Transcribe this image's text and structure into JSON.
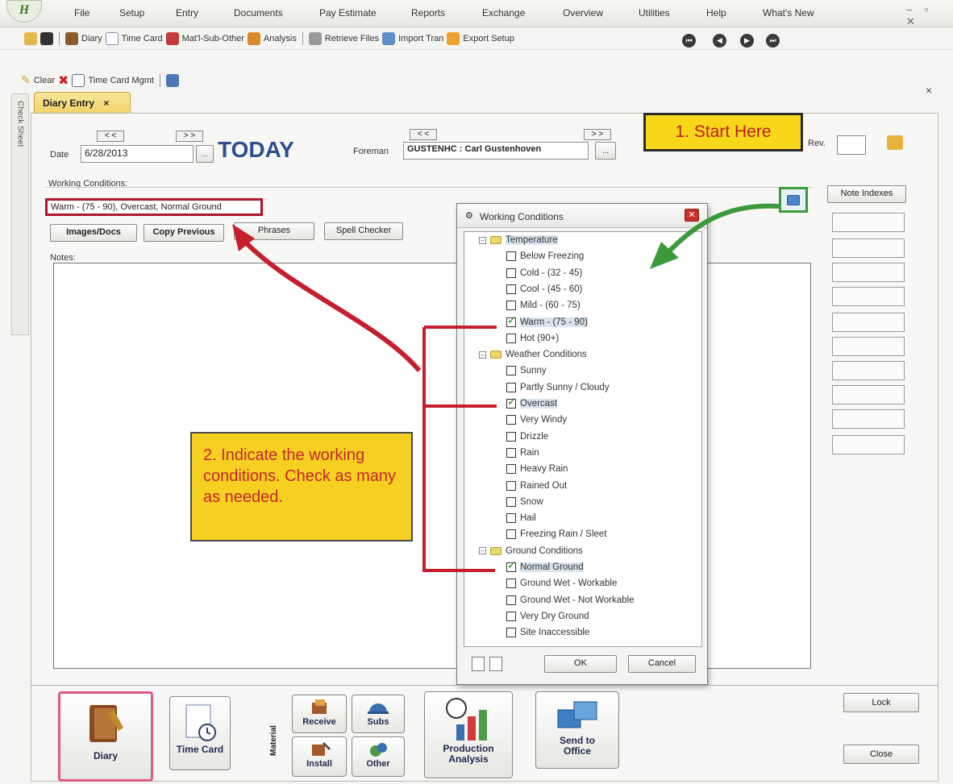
{
  "app": {
    "logo": "H"
  },
  "menu": [
    "File",
    "Setup",
    "Entry",
    "Documents",
    "Pay Estimate",
    "Reports",
    "Exchange",
    "Overview",
    "Utilities",
    "Help",
    "What's New"
  ],
  "toolbar1": {
    "diary": "Diary",
    "time_card": "Time Card",
    "matl": "Mat'l-Sub-Other",
    "analysis": "Analysis",
    "retrieve": "Retrieve Files",
    "import": "Import Tran",
    "export": "Export Setup"
  },
  "toolbar2": {
    "clear": "Clear",
    "time_card_mgmt": "Time Card Mgmt"
  },
  "side_strip": "Check Sheet",
  "tab": {
    "label": "Diary Entry",
    "close": "×"
  },
  "header": {
    "date_label": "Date",
    "date_value": "6/28/2013",
    "today": "TODAY",
    "foreman_label": "Foreman",
    "foreman_value": "GUSTENHC : Carl Gustenhoven",
    "rev_label": "Rev.",
    "prev": "< <",
    "next": "> >",
    "more": "..."
  },
  "callout1": "1. Start Here",
  "working": {
    "label": "Working Conditions:",
    "value": "Warm - (75 - 90), Overcast, Normal Ground"
  },
  "buttons": {
    "images": "Images/Docs",
    "copy_prev": "Copy Previous",
    "phrases": "Phrases",
    "spell": "Spell Checker",
    "note_indexes": "Note Indexes",
    "lock": "Lock",
    "close": "Close"
  },
  "notes_label": "Notes:",
  "popup": {
    "title": "Working Conditions",
    "groups": [
      {
        "name": "Temperature",
        "items": [
          {
            "label": "Below Freezing",
            "checked": false
          },
          {
            "label": "Cold - (32 - 45)",
            "checked": false
          },
          {
            "label": "Cool - (45 - 60)",
            "checked": false
          },
          {
            "label": "Mild - (60 - 75)",
            "checked": false
          },
          {
            "label": "Warm - (75 - 90)",
            "checked": true
          },
          {
            "label": "Hot (90+)",
            "checked": false
          }
        ]
      },
      {
        "name": "Weather Conditions",
        "items": [
          {
            "label": "Sunny",
            "checked": false
          },
          {
            "label": "Partly Sunny / Cloudy",
            "checked": false
          },
          {
            "label": "Overcast",
            "checked": true
          },
          {
            "label": "Very Windy",
            "checked": false
          },
          {
            "label": "Drizzle",
            "checked": false
          },
          {
            "label": "Rain",
            "checked": false
          },
          {
            "label": "Heavy Rain",
            "checked": false
          },
          {
            "label": "Rained Out",
            "checked": false
          },
          {
            "label": "Snow",
            "checked": false
          },
          {
            "label": "Hail",
            "checked": false
          },
          {
            "label": "Freezing Rain / Sleet",
            "checked": false
          }
        ]
      },
      {
        "name": "Ground Conditions",
        "items": [
          {
            "label": "Normal Ground",
            "checked": true
          },
          {
            "label": "Ground Wet - Workable",
            "checked": false
          },
          {
            "label": "Ground Wet - Not Workable",
            "checked": false
          },
          {
            "label": "Very Dry Ground",
            "checked": false
          },
          {
            "label": "Site Inaccessible",
            "checked": false
          }
        ]
      }
    ],
    "ok": "OK",
    "cancel": "Cancel"
  },
  "callout2": "2. Indicate the working conditions. Check as many as needed.",
  "bottom": {
    "diary": "Diary",
    "time_card": "Time Card",
    "material": "Material",
    "receive": "Receive",
    "subs": "Subs",
    "install": "Install",
    "other": "Other",
    "production": "Production Analysis",
    "send": "Send to Office"
  }
}
